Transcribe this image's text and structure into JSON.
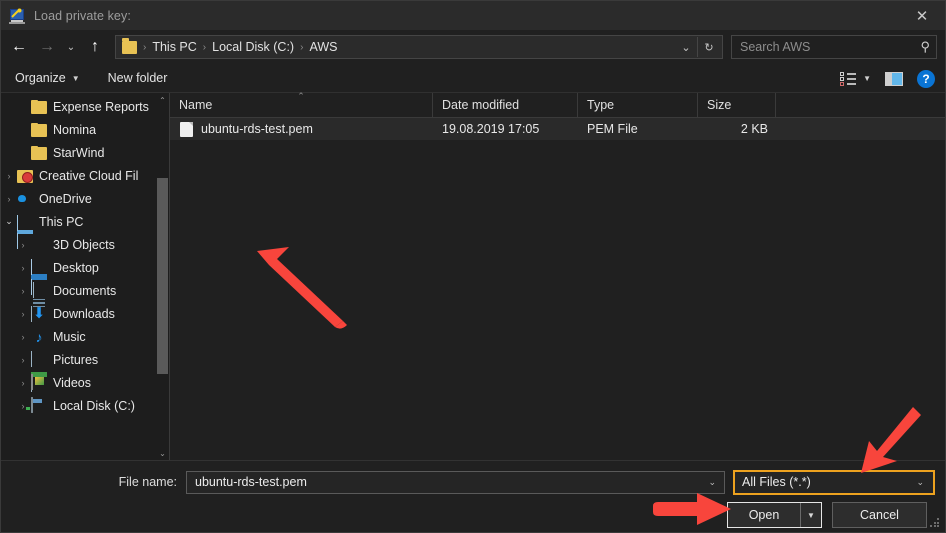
{
  "titlebar": {
    "title": "Load private key:",
    "icon": "putty-key-icon",
    "close_label": "✕"
  },
  "addressbar": {
    "back_icon": "←",
    "forward_icon": "→",
    "recent_icon": "⌄",
    "up_icon": "↑",
    "folder_icon": "folder-icon",
    "separator": "›",
    "breadcrumbs": [
      "This PC",
      "Local Disk (C:)",
      "AWS"
    ],
    "history_caret": "⌄",
    "refresh_icon": "↻",
    "search_placeholder": "Search AWS",
    "search_value": "",
    "search_icon": "⚲"
  },
  "commandbar": {
    "organize_label": "Organize",
    "organize_caret": "▼",
    "new_folder_label": "New folder",
    "view_caret": "▼",
    "help_label": "?"
  },
  "navpane": {
    "scroll_up": "⌃",
    "scroll_down": "⌄",
    "items": [
      {
        "label": "Expense Reports",
        "icon": "folder-icon",
        "indent": 2,
        "chevron": "",
        "kind": "folder"
      },
      {
        "label": "Nomina",
        "icon": "folder-icon",
        "indent": 2,
        "chevron": "",
        "kind": "folder"
      },
      {
        "label": "StarWind",
        "icon": "folder-icon",
        "indent": 2,
        "chevron": "",
        "kind": "folder"
      },
      {
        "label": "Creative Cloud Fil",
        "icon": "creative-cloud-icon",
        "indent": 1,
        "chevron": "›",
        "kind": "cc"
      },
      {
        "label": "OneDrive",
        "icon": "onedrive-icon",
        "indent": 1,
        "chevron": "›",
        "kind": "onedrive"
      },
      {
        "label": "This PC",
        "icon": "this-pc-icon",
        "indent": 1,
        "chevron": "⌄",
        "kind": "pc"
      },
      {
        "label": "3D Objects",
        "icon": "3d-objects-icon",
        "indent": 2,
        "chevron": "›",
        "kind": "3d"
      },
      {
        "label": "Desktop",
        "icon": "desktop-icon",
        "indent": 2,
        "chevron": "›",
        "kind": "desktop"
      },
      {
        "label": "Documents",
        "icon": "documents-icon",
        "indent": 2,
        "chevron": "›",
        "kind": "doc"
      },
      {
        "label": "Downloads",
        "icon": "downloads-icon",
        "indent": 2,
        "chevron": "›",
        "kind": "down"
      },
      {
        "label": "Music",
        "icon": "music-icon",
        "indent": 2,
        "chevron": "›",
        "kind": "music"
      },
      {
        "label": "Pictures",
        "icon": "pictures-icon",
        "indent": 2,
        "chevron": "›",
        "kind": "pics"
      },
      {
        "label": "Videos",
        "icon": "videos-icon",
        "indent": 2,
        "chevron": "›",
        "kind": "video"
      },
      {
        "label": "Local Disk (C:)",
        "icon": "local-disk-icon",
        "indent": 2,
        "chevron": "›",
        "kind": "disk"
      }
    ]
  },
  "filelist": {
    "columns": [
      "Name",
      "Date modified",
      "Type",
      "Size"
    ],
    "sort_column": "Name",
    "sort_indicator": "⌃",
    "rows": [
      {
        "name": "ubuntu-rds-test.pem",
        "date_modified": "19.08.2019 17:05",
        "type": "PEM File",
        "size": "2 KB",
        "icon": "pem-file-icon",
        "selected": true
      }
    ]
  },
  "bottom": {
    "filename_label": "File name:",
    "filename_value": "ubuntu-rds-test.pem",
    "filename_caret": "⌄",
    "filter_value": "All Files (*.*)",
    "filter_caret": "⌄",
    "open_label": "Open",
    "open_split_caret": "▼",
    "cancel_label": "Cancel"
  },
  "annotations": {
    "arrow_color": "#f8453c",
    "highlight_color": "#eda21f",
    "arrows": [
      {
        "name": "arrow-to-file-row",
        "target": "ubuntu-rds-test.pem"
      },
      {
        "name": "arrow-to-file-filter",
        "target": "All Files (*.*)"
      },
      {
        "name": "arrow-to-open-button",
        "target": "Open"
      }
    ]
  }
}
